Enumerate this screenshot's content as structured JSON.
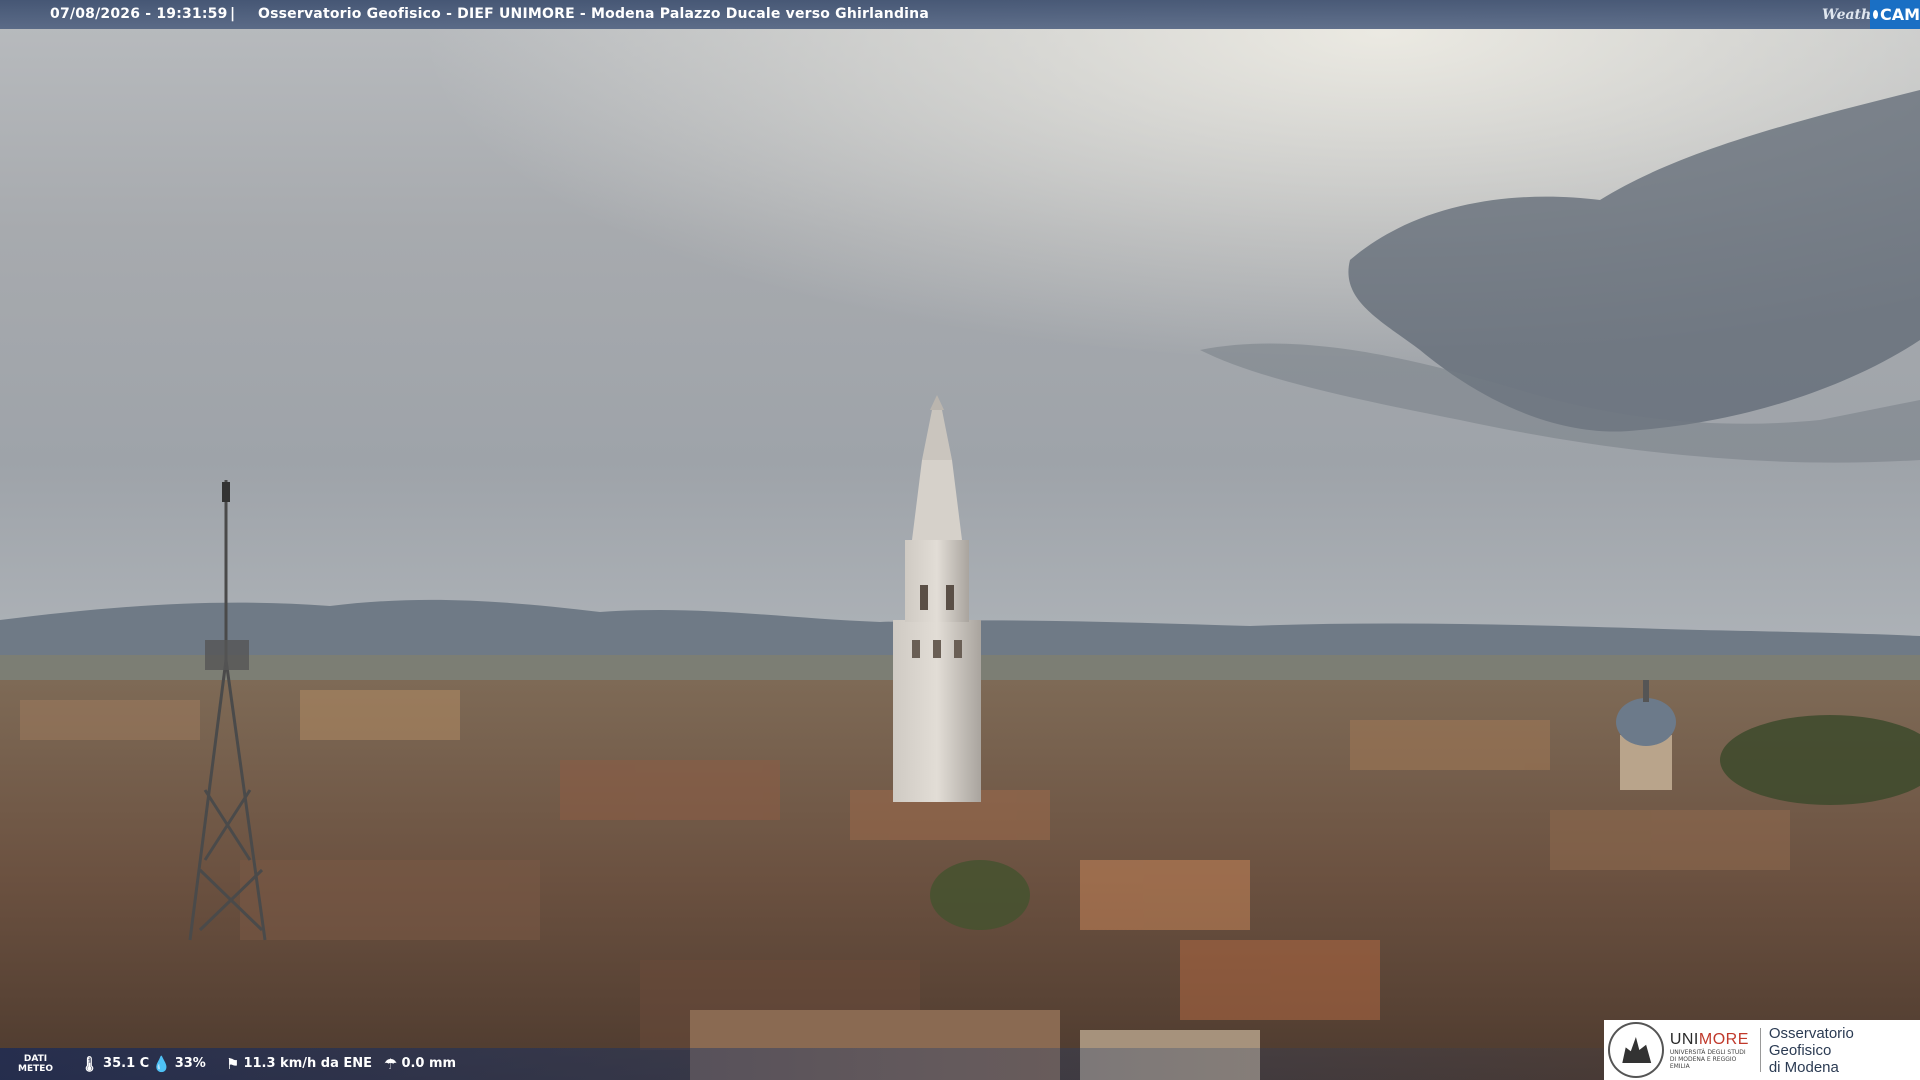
{
  "header": {
    "timestamp": "07/08/2026 - 19:31:59",
    "separator": "|",
    "title": "Osservatorio Geofisico - DIEF UNIMORE - Modena Palazzo Ducale verso Ghirlandina"
  },
  "brand": {
    "weather": "Weather",
    "cam": "CAM"
  },
  "meteo": {
    "label_line1": "DATI",
    "label_line2": "METEO",
    "temperature": "35.1 C",
    "humidity": "33%",
    "wind": "11.3 km/h da ENE",
    "rain": "0.0 mm",
    "icons": [
      "thermometer-icon",
      "humidity-drop-icon",
      "wind-icon",
      "rain-icon"
    ]
  },
  "logo": {
    "uni_a": "UNI",
    "uni_b": "MORE",
    "uni_sub": "UNIVERSITÀ DEGLI STUDI DI MODENA E REGGIO EMILIA",
    "obs_line1": "Osservatorio Geofisico",
    "obs_line2": "di Modena"
  },
  "colors": {
    "topbar": "#4e6080",
    "cam_blue": "#1a6fc4",
    "unimore_red": "#c0392b"
  }
}
